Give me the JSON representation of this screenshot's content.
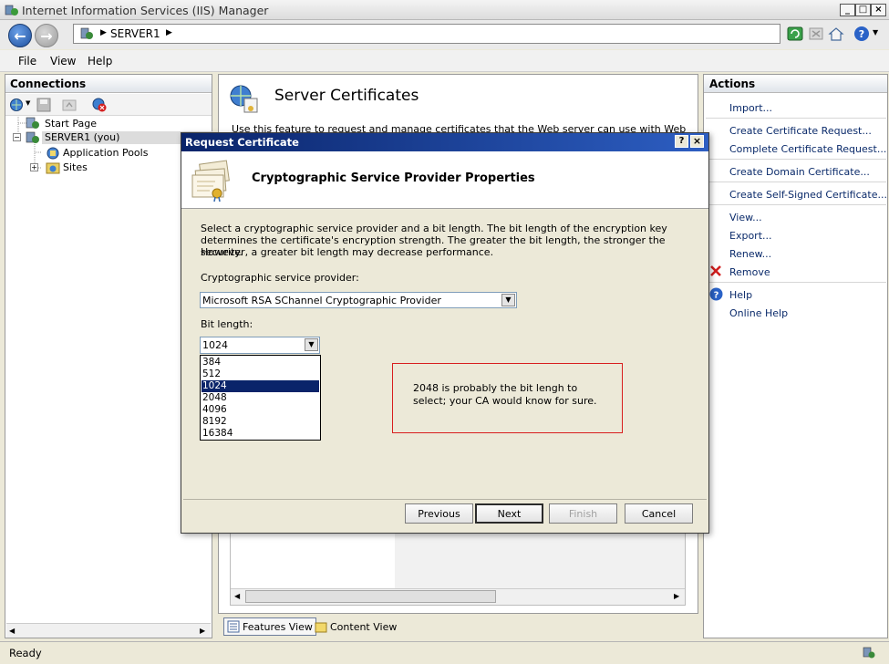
{
  "window": {
    "title": "Internet Information Services (IIS) Manager"
  },
  "address": {
    "path": "SERVER1"
  },
  "menu": [
    "File",
    "View",
    "Help"
  ],
  "connections": {
    "title": "Connections",
    "tree": [
      "Start Page",
      "SERVER1 (you)",
      "Application Pools",
      "Sites"
    ]
  },
  "center": {
    "title": "Server Certificates",
    "description_fragment": "Use this feature to request and manage certificates that the Web server can use with Web sites",
    "tabs": [
      "Features View",
      "Content View"
    ]
  },
  "actions": {
    "title": "Actions",
    "items": [
      "Import...",
      "Create Certificate Request...",
      "Complete Certificate Request...",
      "Create Domain Certificate...",
      "Create Self-Signed Certificate...",
      "View...",
      "Export...",
      "Renew...",
      "Remove",
      "Help",
      "Online Help"
    ]
  },
  "status": {
    "text": "Ready"
  },
  "dialog": {
    "title": "Request Certificate",
    "heading": "Cryptographic Service Provider Properties",
    "instructions": [
      "Select a cryptographic service provider and a bit length. The bit length of the encryption key",
      "determines the certificate's encryption strength. The greater the bit length, the stronger the security.",
      "However, a greater bit length may decrease performance."
    ],
    "csp_label": "Cryptographic service provider:",
    "csp_value": "Microsoft RSA SChannel Cryptographic Provider",
    "bit_label": "Bit length:",
    "bit_value": "1024",
    "bit_options": [
      "384",
      "512",
      "1024",
      "2048",
      "4096",
      "8192",
      "16384"
    ],
    "bit_selected_index": 2,
    "buttons": {
      "previous": "Previous",
      "next": "Next",
      "finish": "Finish",
      "cancel": "Cancel"
    }
  },
  "annotation": {
    "line1": "2048 is probably the bit lengh to",
    "line2": "select; your CA would know for sure."
  }
}
